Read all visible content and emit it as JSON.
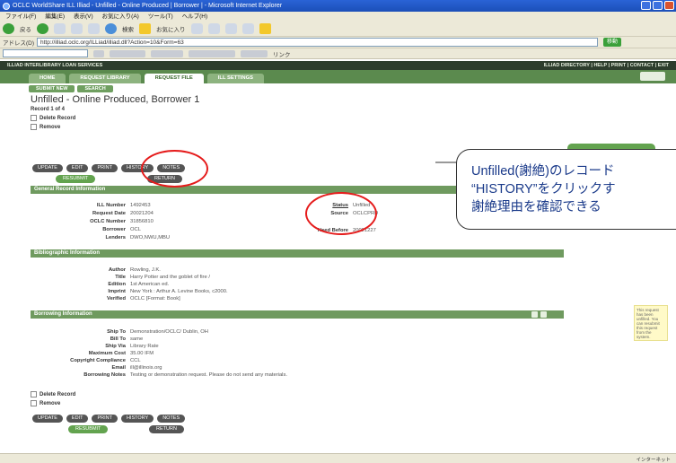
{
  "browser": {
    "title": "OCLC WorldShare ILL Illiad - Unfilled - Online Produced | Borrower | - Microsoft Internet Explorer",
    "menu": [
      "ファイル(F)",
      "編集(E)",
      "表示(V)",
      "お気に入り(A)",
      "ツール(T)",
      "ヘルプ(H)"
    ],
    "toolbar_labels": [
      "戻る",
      "検索",
      "お気に入り"
    ],
    "address_label": "アドレス(D)",
    "address": "http://illiad.oclc.org/ILLiad/illiad.dll?Action=10&Form=63",
    "go_label": "移動",
    "links_label": "リンク"
  },
  "site": {
    "header_left": "ILLIAD INTERLIBRARY LOAN SERVICES",
    "header_right": "ILLIAD DIRECTORY | HELP | PRINT | CONTACT | EXIT",
    "tabs": [
      "HOME",
      "REQUEST LIBRARY",
      "REQUEST FILE",
      "ILL SETTINGS"
    ],
    "subtabs": [
      "SUBMIT NEW",
      "SEARCH"
    ]
  },
  "record": {
    "title": "Unfilled - Online Produced, Borrower 1",
    "count": "Record 1 of 4",
    "delete_label": "Delete Record",
    "remove_label": "Remove",
    "buttons": [
      "UPDATE",
      "EDIT",
      "PRINT",
      "HISTORY",
      "NOTES"
    ],
    "green_button": "RESUBMIT",
    "dark_button": "RETURN"
  },
  "general": {
    "heading": "General Record Information",
    "fields": [
      {
        "k": "ILL Number",
        "v": "1492453"
      },
      {
        "k": "Request Date",
        "v": "20021204"
      },
      {
        "k": "OCLC Number",
        "v": "31856810"
      },
      {
        "k": "Borrower",
        "v": "OCL"
      },
      {
        "k": "Lenders",
        "v": "DWO,NWU,MBU"
      }
    ],
    "status_k": "Status",
    "status_v": "Unfilled",
    "source_k": "Source",
    "source_v": "OCLCPRD",
    "need_k": "Need Before",
    "need_v": "20021227"
  },
  "biblio": {
    "heading": "Bibliographic Information",
    "fields": [
      {
        "k": "Author",
        "v": "Rowling, J.K."
      },
      {
        "k": "Title",
        "v": "Harry Potter and the goblet of fire /"
      },
      {
        "k": "Edition",
        "v": "1st American ed."
      },
      {
        "k": "Imprint",
        "v": "New York : Arthur A. Levine Books, c2000."
      },
      {
        "k": "Verified",
        "v": "OCLC [Format: Book]"
      }
    ]
  },
  "borrowing": {
    "heading": "Borrowing Information",
    "fields": [
      {
        "k": "Ship To",
        "v": "Demonstration/OCLC/ Dublin, OH"
      },
      {
        "k": "Bill To",
        "v": "same"
      },
      {
        "k": "Ship Via",
        "v": "Library Rate"
      },
      {
        "k": "Maximum Cost",
        "v": "35.00 IFM"
      },
      {
        "k": "Copyright Compliance",
        "v": "CCL"
      },
      {
        "k": "Email",
        "v": "ill@illinois.org"
      },
      {
        "k": "Borrowing Notes",
        "v": "Testing or demonstration request. Please do not send any materials."
      }
    ]
  },
  "bottom": {
    "delete_label": "Delete Record",
    "remove_label": "Remove",
    "buttons": [
      "UPDATE",
      "EDIT",
      "PRINT",
      "HISTORY",
      "NOTES"
    ],
    "green_button": "RESUBMIT",
    "dark_button": "RETURN"
  },
  "side_note": "This request has been unfilled. You can resubmit this request from the system.",
  "status_zone": "インターネット",
  "callout": {
    "line1": "Unfilled(謝絶)のレコード",
    "line2": "“HISTORY”をクリックす",
    "line3": "謝絶理由を確認できる"
  },
  "colors": {
    "annotation": "#e51b1b",
    "callout_text": "#1a3a8a",
    "section": "#6f9a5f"
  }
}
